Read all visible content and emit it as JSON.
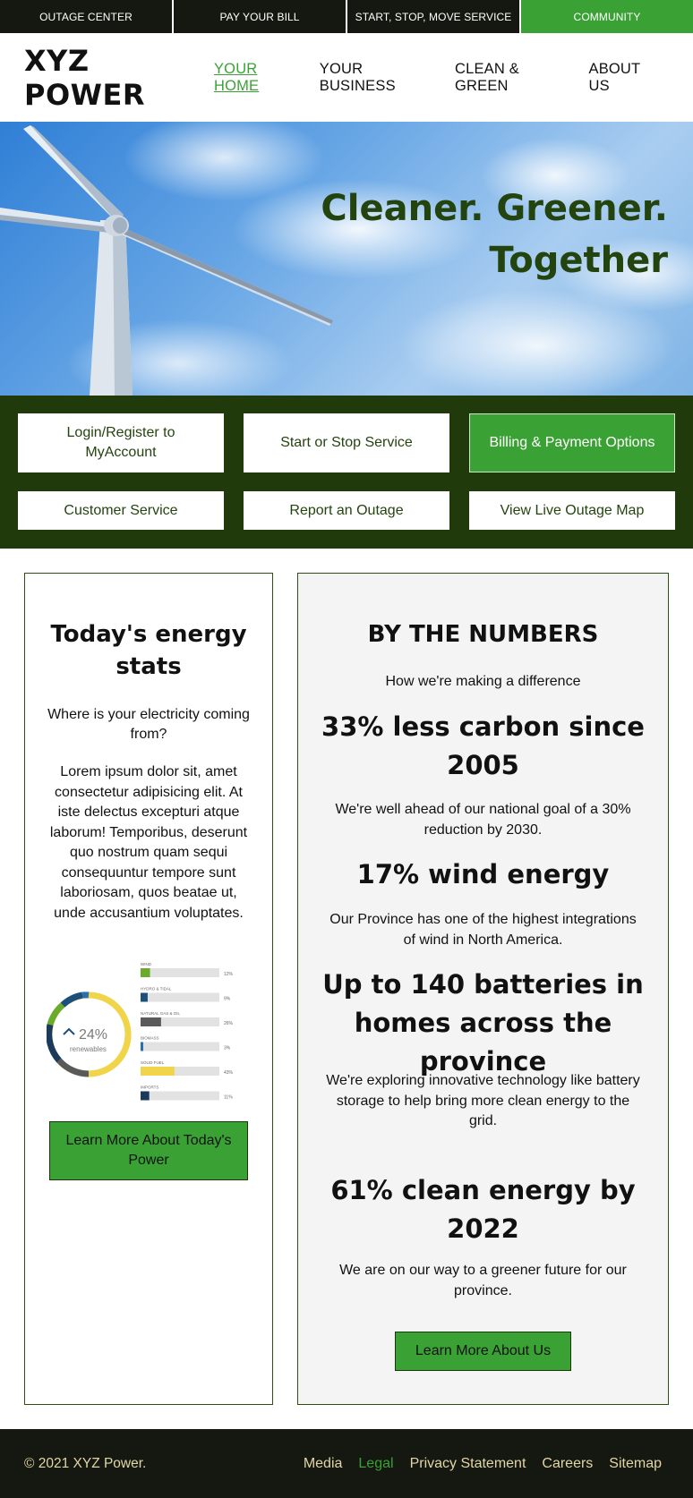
{
  "utility_nav": [
    {
      "label": "OUTAGE CENTER",
      "active": false
    },
    {
      "label": "PAY YOUR BILL",
      "active": false
    },
    {
      "label": "START, STOP, MOVE SERVICE",
      "active": false
    },
    {
      "label": "COMMUNITY",
      "active": true
    }
  ],
  "header": {
    "logo": "XYZ POWER",
    "nav": [
      {
        "label": "YOUR HOME",
        "active": true
      },
      {
        "label": "YOUR BUSINESS",
        "active": false
      },
      {
        "label": "CLEAN & GREEN",
        "active": false
      },
      {
        "label": "ABOUT US",
        "active": false
      }
    ]
  },
  "hero": {
    "title_line1": "Cleaner. Greener.",
    "title_line2": "Together"
  },
  "quick_links": [
    {
      "label": "Login/Register to MyAccount"
    },
    {
      "label": "Start or Stop Service"
    },
    {
      "label": "Billing & Payment Options",
      "highlight": true
    },
    {
      "label": "Customer Service"
    },
    {
      "label": "Report an Outage"
    },
    {
      "label": "View Live Outage Map"
    }
  ],
  "energy_stats": {
    "title": "Today's energy stats",
    "subtitle": "Where is your electricity coming from?",
    "body": "Lorem ipsum dolor sit, amet consectetur adipisicing elit. At iste delectus excepturi atque laborum! Temporibus, deserunt quo nostrum quam sequi consequuntur tempore sunt laboriosam, quos beatae ut, unde accusantium voluptates.",
    "donut_value": "24%",
    "donut_label": "renewables",
    "sources": [
      {
        "name": "WIND",
        "value": 12,
        "value_label": "12%",
        "color": "#6aab2e"
      },
      {
        "name": "HYDRO & TIDAL",
        "value": 9,
        "value_label": "9%",
        "color": "#1d4f7c"
      },
      {
        "name": "NATURAL GAS & OIL",
        "value": 26,
        "value_label": "26%",
        "color": "#5a5a5a"
      },
      {
        "name": "BIOMASS",
        "value": 3,
        "value_label": "3%",
        "color": "#2a6fb0"
      },
      {
        "name": "SOLID FUEL",
        "value": 43,
        "value_label": "43%",
        "color": "#f0d44a"
      },
      {
        "name": "IMPORTS",
        "value": 11,
        "value_label": "11%",
        "color": "#1b3a5c"
      }
    ],
    "button_label": "Learn More About Today's Power"
  },
  "by_the_numbers": {
    "title": "BY THE NUMBERS",
    "subtitle": "How we're making a difference",
    "stats": [
      {
        "headline": "33% less carbon since 2005",
        "text": "We're well ahead of our national goal of a 30% reduction by 2030."
      },
      {
        "headline": "17% wind energy",
        "text": "Our Province has one of the highest integrations of wind in North America."
      },
      {
        "headline": "Up to 140 batteries in homes across the province",
        "text": "We're exploring innovative technology like battery storage to help bring more clean energy to the grid."
      },
      {
        "headline": "61% clean energy by 2022",
        "text": "We are on our way to a greener future for our province."
      }
    ],
    "button_label": "Learn More About Us"
  },
  "footer": {
    "copyright": "© 2021 XYZ Power.",
    "links": [
      {
        "label": "Media",
        "active": false
      },
      {
        "label": "Legal",
        "active": true
      },
      {
        "label": "Privacy Statement",
        "active": false
      },
      {
        "label": "Careers",
        "active": false
      },
      {
        "label": "Sitemap",
        "active": false
      }
    ]
  },
  "colors": {
    "brand_green": "#3aa234",
    "dark_green": "#203a0b",
    "headline_green": "#24440f",
    "footer_bg": "#141810",
    "footer_text": "#e3d6a6"
  }
}
